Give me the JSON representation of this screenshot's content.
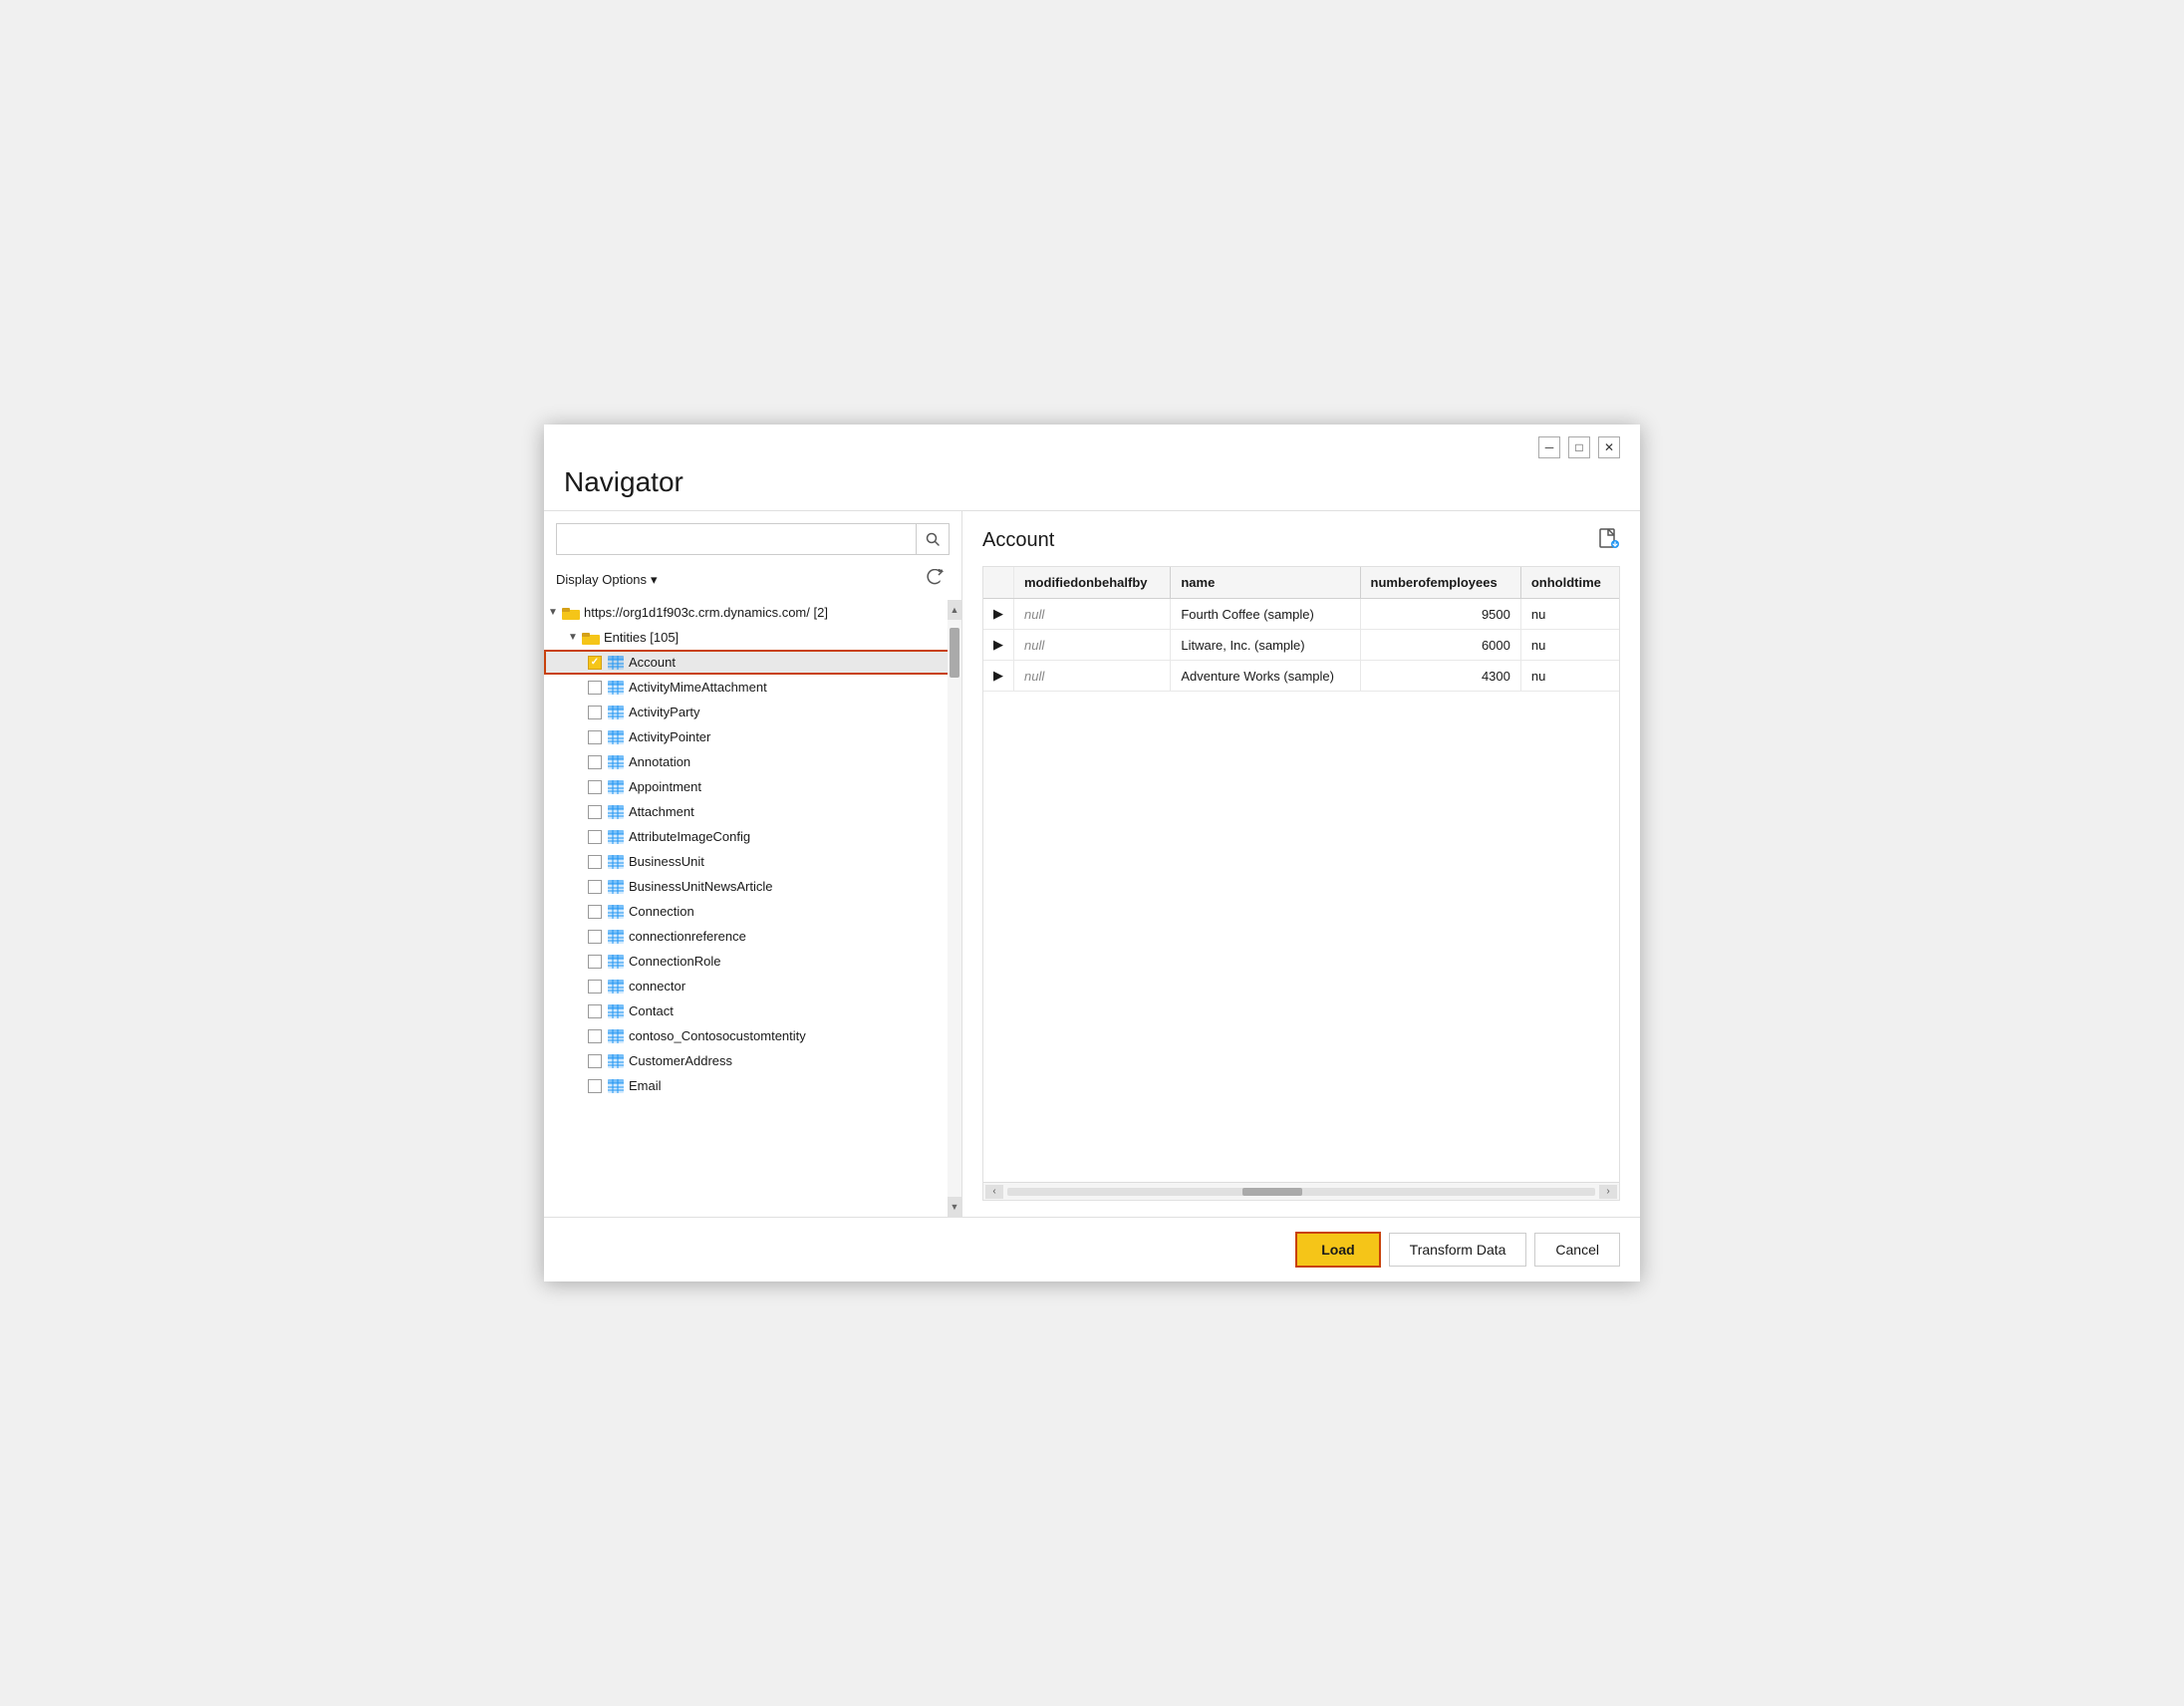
{
  "dialog": {
    "title": "Navigator"
  },
  "search": {
    "placeholder": ""
  },
  "display_options": {
    "label": "Display Options",
    "dropdown_arrow": "▾"
  },
  "tree": {
    "root": {
      "label": "https://org1d1f903c.crm.dynamics.com/ [2]",
      "expanded": true
    },
    "entities_node": {
      "label": "Entities [105]",
      "expanded": true
    },
    "items": [
      {
        "label": "Account",
        "checked": true,
        "selected": true
      },
      {
        "label": "ActivityMimeAttachment",
        "checked": false
      },
      {
        "label": "ActivityParty",
        "checked": false
      },
      {
        "label": "ActivityPointer",
        "checked": false
      },
      {
        "label": "Annotation",
        "checked": false
      },
      {
        "label": "Appointment",
        "checked": false
      },
      {
        "label": "Attachment",
        "checked": false
      },
      {
        "label": "AttributeImageConfig",
        "checked": false
      },
      {
        "label": "BusinessUnit",
        "checked": false
      },
      {
        "label": "BusinessUnitNewsArticle",
        "checked": false
      },
      {
        "label": "Connection",
        "checked": false
      },
      {
        "label": "connectionreference",
        "checked": false
      },
      {
        "label": "ConnectionRole",
        "checked": false
      },
      {
        "label": "connector",
        "checked": false
      },
      {
        "label": "Contact",
        "checked": false
      },
      {
        "label": "contoso_Contosocustomtentity",
        "checked": false
      },
      {
        "label": "CustomerAddress",
        "checked": false
      },
      {
        "label": "Email",
        "checked": false
      }
    ]
  },
  "right_panel": {
    "title": "Account",
    "columns": [
      {
        "id": "modifiedonbehalfby",
        "label": "modifiedonbehalfby"
      },
      {
        "id": "name",
        "label": "name"
      },
      {
        "id": "numberofemployees",
        "label": "numberofemployees"
      },
      {
        "id": "onholdtime",
        "label": "onholdtime"
      }
    ],
    "rows": [
      {
        "modifiedonbehalfby": "null",
        "name": "Fourth Coffee (sample)",
        "numberofemployees": "9500",
        "onholdtime": "nu"
      },
      {
        "modifiedonbehalfby": "null",
        "name": "Litware, Inc. (sample)",
        "numberofemployees": "6000",
        "onholdtime": "nu"
      },
      {
        "modifiedonbehalfby": "null",
        "name": "Adventure Works (sample)",
        "numberofemployees": "4300",
        "onholdtime": "nu"
      }
    ]
  },
  "buttons": {
    "load": "Load",
    "transform_data": "Transform Data",
    "cancel": "Cancel"
  }
}
